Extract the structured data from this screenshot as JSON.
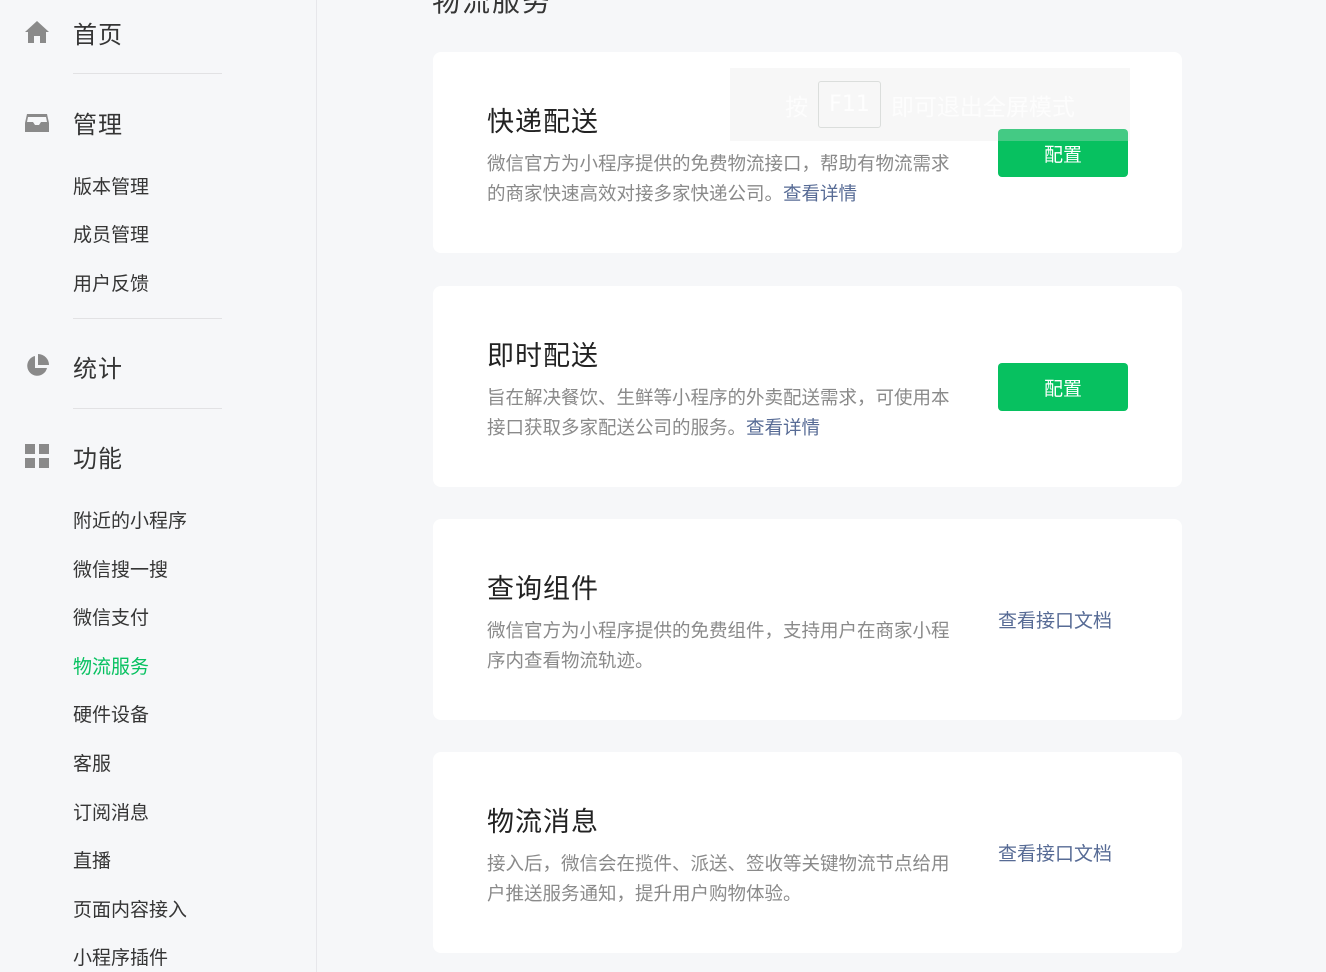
{
  "sidebar": {
    "categories": [
      {
        "label": "首页",
        "icon": "home-icon"
      },
      {
        "label": "管理",
        "icon": "inbox-icon"
      },
      {
        "label": "统计",
        "icon": "pie-chart-icon"
      },
      {
        "label": "功能",
        "icon": "grid-icon"
      }
    ],
    "manage_items": [
      "版本管理",
      "成员管理",
      "用户反馈"
    ],
    "feature_items": [
      "附近的小程序",
      "微信搜一搜",
      "微信支付",
      "物流服务",
      "硬件设备",
      "客服",
      "订阅消息",
      "直播",
      "页面内容接入",
      "小程序插件"
    ],
    "active_item": "物流服务"
  },
  "main": {
    "title": "物流服务",
    "cards": [
      {
        "title": "快递配送",
        "desc": "微信官方为小程序提供的免费物流接口，帮助有物流需求的商家快速高效对接多家快递公司。",
        "link": "查看详情",
        "action": "配置"
      },
      {
        "title": "即时配送",
        "desc": "旨在解决餐饮、生鲜等小程序的外卖配送需求，可使用本接口获取多家配送公司的服务。",
        "link": "查看详情",
        "action": "配置"
      },
      {
        "title": "查询组件",
        "desc": "微信官方为小程序提供的免费组件，支持用户在商家小程序内查看物流轨迹。",
        "action": "查看接口文档"
      },
      {
        "title": "物流消息",
        "desc": "接入后，微信会在揽件、派送、签收等关键物流节点给用户推送服务通知，提升用户购物体验。",
        "action": "查看接口文档"
      }
    ]
  },
  "overlay": {
    "prefix": "按",
    "key": "F11",
    "suffix": "即可退出全屏模式"
  },
  "colors": {
    "accent": "#07c160",
    "link": "#576b95",
    "icon": "#8a8a8a"
  }
}
